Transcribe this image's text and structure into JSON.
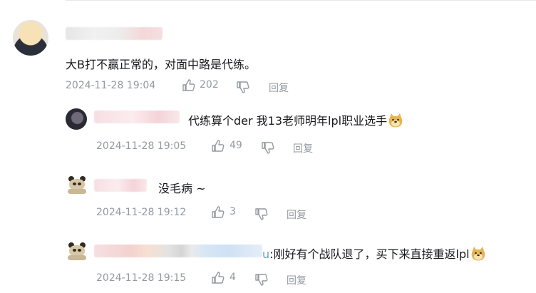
{
  "comments": [
    {
      "text": "大B打不赢正常的，对面中路是代练。",
      "timestamp": "2024-11-28 19:04",
      "like_count": "202",
      "reply_label": "回复",
      "avatar_icon": "anime-avatar"
    },
    {
      "text": "代练算个der 我13老师明年lpl职业选手",
      "timestamp": "2024-11-28 19:05",
      "like_count": "49",
      "reply_label": "回复",
      "avatar_icon": "dark-avatar",
      "trailing_emoji": "doge-emoji"
    },
    {
      "text": "没毛病 ~",
      "timestamp": "2024-11-28 19:12",
      "like_count": "3",
      "reply_label": "回复",
      "avatar_icon": "panda-avatar"
    },
    {
      "handle_tail": "u",
      "text": ":刚好有个战队退了，买下来直接重返lpl",
      "timestamp": "2024-11-28 19:15",
      "like_count": "4",
      "reply_label": "回复",
      "avatar_icon": "panda-avatar",
      "trailing_emoji": "doge-emoji"
    }
  ],
  "colors": {
    "text": "#18191c",
    "meta": "#9499a0",
    "link": "#6b9fd4"
  }
}
